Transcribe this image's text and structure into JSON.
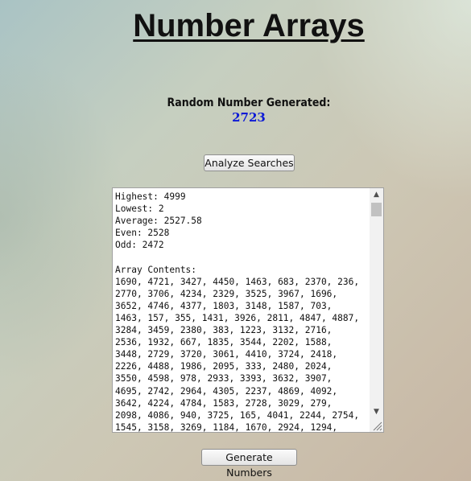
{
  "page": {
    "title": "Number Arrays",
    "random_label": "Random Number Generated:",
    "random_value": "2723"
  },
  "buttons": {
    "analyze_label": "Analyze Searches",
    "generate_label": "Generate Numbers"
  },
  "output": {
    "text": "Highest: 4999\nLowest: 2\nAverage: 2527.58\nEven: 2528\nOdd: 2472\n\nArray Contents:\n1690, 4721, 3427, 4450, 1463, 683, 2370, 236,\n2770, 3706, 4234, 2329, 3525, 3967, 1696,\n3652, 4746, 4377, 1803, 3148, 1587, 703,\n1463, 157, 355, 1431, 3926, 2811, 4847, 4887,\n3284, 3459, 2380, 383, 1223, 3132, 2716,\n2536, 1932, 667, 1835, 3544, 2202, 1588,\n3448, 2729, 3720, 3061, 4410, 3724, 2418,\n2226, 4488, 1986, 2095, 333, 2480, 2024,\n3550, 4598, 978, 2933, 3393, 3632, 3907,\n4695, 2742, 2964, 4305, 2237, 4869, 4092,\n3642, 4224, 4784, 1583, 2728, 3029, 279,\n2098, 4086, 940, 3725, 165, 4041, 2244, 2754,\n1545, 3158, 3269, 1184, 1670, 2924, 1294,"
  },
  "icons": {
    "scroll_up": "scroll-up-arrow",
    "scroll_down": "scroll-down-arrow",
    "resize": "resize-grip"
  },
  "colors": {
    "random_value": "#0b18d6"
  }
}
